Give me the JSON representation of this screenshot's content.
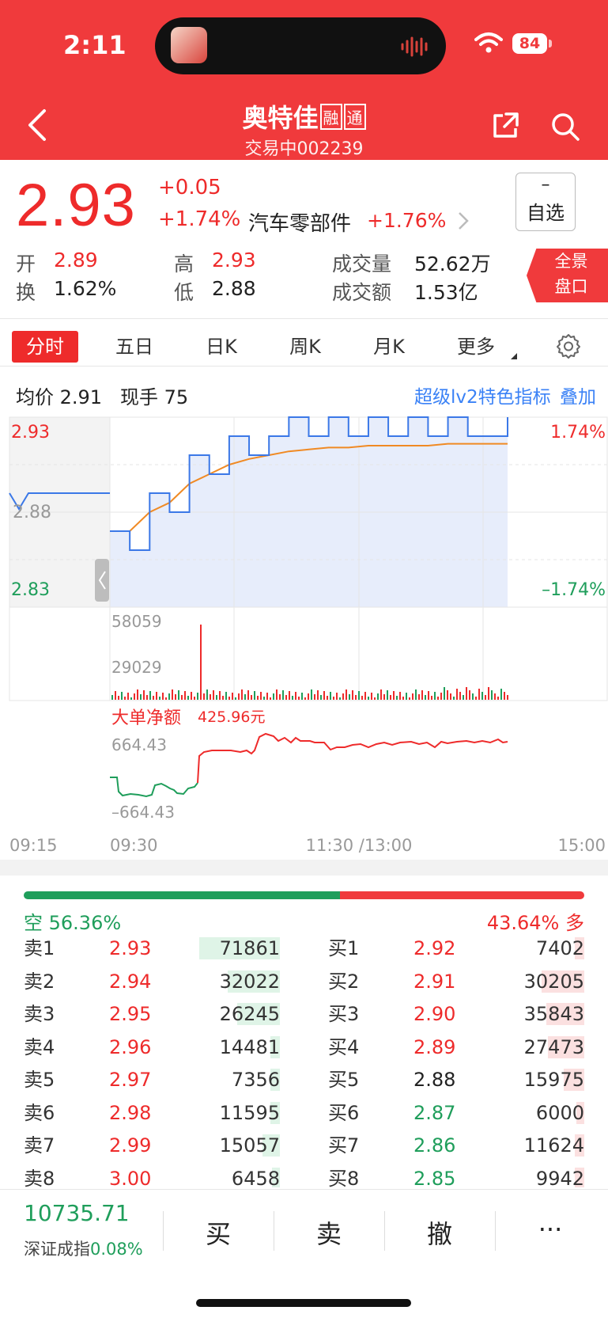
{
  "status_bar": {
    "time": "2:11",
    "battery": "84"
  },
  "header": {
    "stock_name": "奥特佳",
    "tags": [
      "融",
      "通"
    ],
    "status": "交易中",
    "code": "002239"
  },
  "quote": {
    "price": "2.93",
    "change": "+0.05",
    "change_pct": "+1.74%",
    "sector": "汽车零部件",
    "sector_pct": "+1.76%",
    "watch_symbol": "–",
    "watch_label": "自选",
    "open_label": "开",
    "open": "2.89",
    "high_label": "高",
    "high": "2.93",
    "volume_label": "成交量",
    "volume": "52.62万",
    "turnover_label": "换",
    "turnover": "1.62%",
    "low_label": "低",
    "low": "2.88",
    "amount_label": "成交额",
    "amount": "1.53亿",
    "panorama": [
      "全景",
      "盘口"
    ]
  },
  "tabs": [
    "分时",
    "五日",
    "日K",
    "周K",
    "月K",
    "更多"
  ],
  "info_line": {
    "avg_label": "均价",
    "avg": "2.91",
    "last_lot_label": "现手",
    "last_lot": "75",
    "superlv2": "超级lv2特色指标",
    "overlay": "叠加"
  },
  "chart": {
    "price_high": "2.93",
    "price_mid": "2.88",
    "price_low": "2.83",
    "pct_high": "1.74%",
    "pct_low": "–1.74%",
    "vol_max": "58059",
    "vol_mid": "29029",
    "flow_title": "大单净额",
    "flow_value": "425.96元",
    "flow_max": "664.43",
    "flow_min": "–664.43",
    "times": [
      "09:15",
      "09:30",
      "11:30 /13:00",
      "15:00"
    ],
    "colors": {
      "price": "#3b78e7",
      "avg": "#f08a24",
      "up": "#ee2b2b",
      "down": "#1f9e5b"
    }
  },
  "chart_data": {
    "type": "line",
    "x_range": [
      "09:30",
      "15:00"
    ],
    "ylim": [
      2.83,
      2.93
    ],
    "series": [
      {
        "name": "price",
        "values": [
          2.87,
          2.86,
          2.89,
          2.88,
          2.91,
          2.9,
          2.92,
          2.91,
          2.92,
          2.93,
          2.92,
          2.93,
          2.92,
          2.93,
          2.92,
          2.93,
          2.92,
          2.93,
          2.92,
          2.92,
          2.93
        ]
      },
      {
        "name": "avg",
        "values": [
          2.87,
          2.87,
          2.88,
          2.885,
          2.895,
          2.9,
          2.905,
          2.908,
          2.91,
          2.912,
          2.913,
          2.914,
          2.914,
          2.915,
          2.915,
          2.915,
          2.915,
          2.916,
          2.916,
          2.916,
          2.916
        ]
      }
    ],
    "volume_max": 58059
  },
  "order_book": {
    "short_label": "空",
    "short_pct": "56.36%",
    "long_pct": "43.64%",
    "long_label": "多",
    "short_ratio": 0.5636,
    "sells": [
      {
        "label": "卖1",
        "price": "2.93",
        "qty": "71861",
        "color": "r",
        "fill": 0.85
      },
      {
        "label": "卖2",
        "price": "2.94",
        "qty": "32022",
        "color": "r",
        "fill": 0.55
      },
      {
        "label": "卖3",
        "price": "2.95",
        "qty": "26245",
        "color": "r",
        "fill": 0.45
      },
      {
        "label": "卖4",
        "price": "2.96",
        "qty": "14481",
        "color": "r",
        "fill": 0.1
      },
      {
        "label": "卖5",
        "price": "2.97",
        "qty": "7356",
        "color": "r",
        "fill": 0.1
      },
      {
        "label": "卖6",
        "price": "2.98",
        "qty": "11595",
        "color": "r",
        "fill": 0.1
      },
      {
        "label": "卖7",
        "price": "2.99",
        "qty": "15057",
        "color": "r",
        "fill": 0.18
      },
      {
        "label": "卖8",
        "price": "3.00",
        "qty": "6458",
        "color": "r",
        "fill": 0.08
      }
    ],
    "buys": [
      {
        "label": "买1",
        "price": "2.92",
        "qty": "7402",
        "color": "r",
        "fill": 0.1
      },
      {
        "label": "买2",
        "price": "2.91",
        "qty": "30205",
        "color": "r",
        "fill": 0.45
      },
      {
        "label": "买3",
        "price": "2.90",
        "qty": "35843",
        "color": "r",
        "fill": 0.4
      },
      {
        "label": "买4",
        "price": "2.89",
        "qty": "27473",
        "color": "r",
        "fill": 0.38
      },
      {
        "label": "买5",
        "price": "2.88",
        "qty": "15975",
        "color": "b",
        "fill": 0.22
      },
      {
        "label": "买6",
        "price": "2.87",
        "qty": "6000",
        "color": "g",
        "fill": 0.08
      },
      {
        "label": "买7",
        "price": "2.86",
        "qty": "11624",
        "color": "g",
        "fill": 0.1
      },
      {
        "label": "买8",
        "price": "2.85",
        "qty": "9942",
        "color": "g",
        "fill": 0.1
      }
    ]
  },
  "bottom_bar": {
    "index_value": "10735.71",
    "index_name": "深证成指",
    "index_pct": "0.08%",
    "buy": "买",
    "sell": "卖",
    "cancel": "撤",
    "more": "···"
  }
}
